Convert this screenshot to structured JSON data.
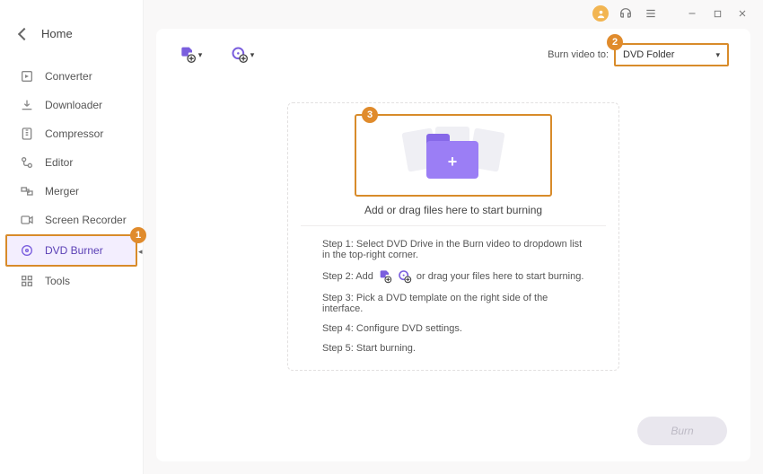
{
  "sidebar": {
    "home_label": "Home",
    "items": [
      {
        "label": "Converter"
      },
      {
        "label": "Downloader"
      },
      {
        "label": "Compressor"
      },
      {
        "label": "Editor"
      },
      {
        "label": "Merger"
      },
      {
        "label": "Screen Recorder"
      },
      {
        "label": "DVD Burner"
      },
      {
        "label": "Tools"
      }
    ]
  },
  "toolbar": {
    "burn_to_label": "Burn video to:",
    "burn_to_value": "DVD Folder"
  },
  "drop": {
    "text": "Add or drag files here to start burning"
  },
  "steps": {
    "s1": "Step 1: Select DVD Drive in the Burn video to dropdown list in the top-right corner.",
    "s2a": "Step 2: Add",
    "s2b": "or drag your files here to start burning.",
    "s3": "Step 3: Pick a DVD template on the right side of the interface.",
    "s4": "Step 4: Configure DVD settings.",
    "s5": "Step 5: Start burning."
  },
  "footer": {
    "burn": "Burn"
  },
  "callouts": {
    "c1": "1",
    "c2": "2",
    "c3": "3"
  }
}
